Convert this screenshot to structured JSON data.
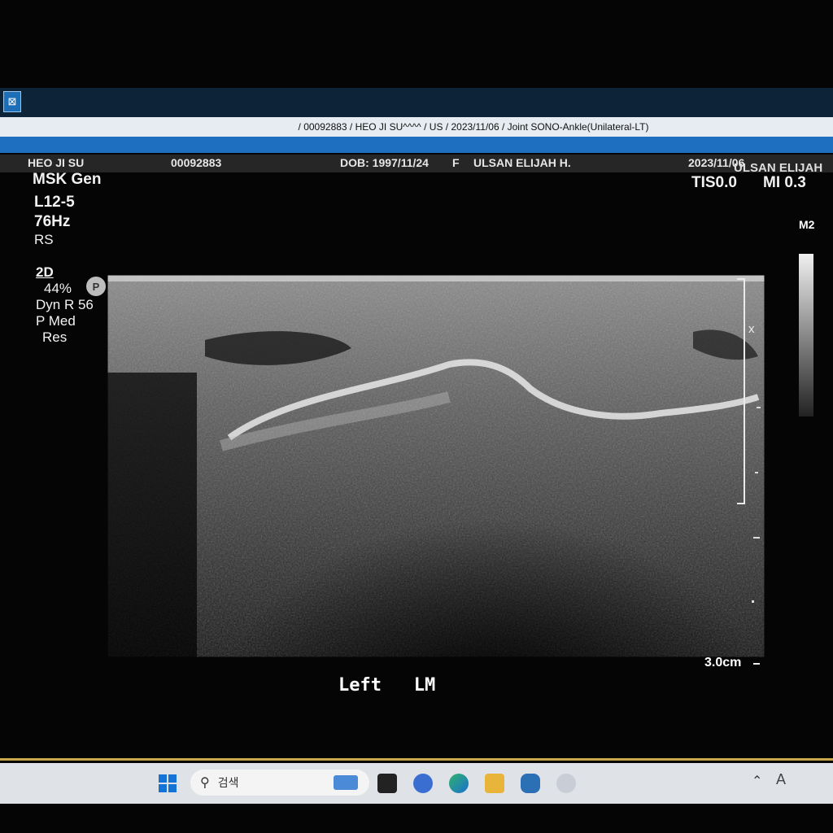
{
  "window": {
    "title": "/ 00092883 / HEO JI SU^^^^ / US / 2023/11/06 / Joint SONO-Ankle(Unilateral-LT)",
    "close_glyph": "⊠"
  },
  "header": {
    "left_char": "F",
    "patient_name": "HEO JI SU",
    "patient_id": "00092883",
    "dob": "DOB: 1997/11/24",
    "sex": "F",
    "institution": "ULSAN ELIJAH H.",
    "datetime": "2023/11/06",
    "institution_right": "ULSAN ELIJAH"
  },
  "params": {
    "preset": "MSK Gen",
    "probe": "L12-5",
    "frame_rate": "76Hz",
    "rs": "RS",
    "mode": "2D",
    "gain": "44%",
    "gain_badge": "P",
    "dyn_range": "Dyn R 56",
    "persistence": "P Med",
    "res": "Res"
  },
  "indices": {
    "tis": "TIS0.0",
    "mi": "MI 0.3",
    "map": "M2"
  },
  "image": {
    "depth": "3.0cm",
    "focus_marker": "x",
    "annotation": "Left   LM"
  },
  "taskbar": {
    "search_placeholder": "검색",
    "icons": [
      "windows-start-icon",
      "search-icon",
      "file-explorer-icon",
      "terminal-icon",
      "chat-icon",
      "edge-icon",
      "folder-icon",
      "app-icon",
      "viewer-icon",
      "chevron-up-icon",
      "ime-icon"
    ]
  },
  "colors": {
    "accent": "#1f6fc0",
    "header_bg": "#262626"
  }
}
